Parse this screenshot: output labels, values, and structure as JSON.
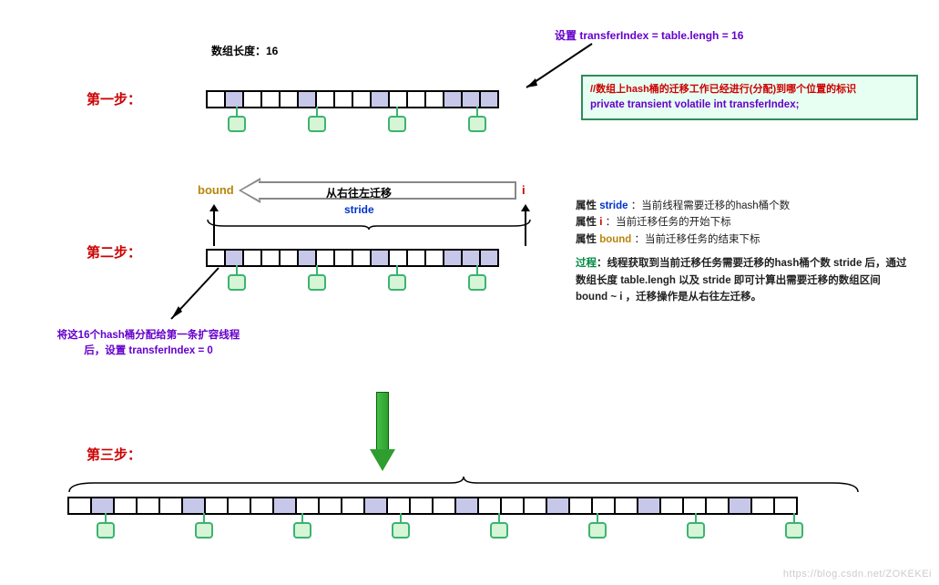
{
  "array_length_label": "数组长度：16",
  "step1_label": "第一步：",
  "step2_label": "第二步：",
  "step3_label": "第三步：",
  "set_transfer_index": "设置 transferIndex = table.lengh = 16",
  "codebox_comment": "//数组上hash桶的迁移工作已经进行(分配)到哪个位置的标识",
  "codebox_decl": "private transient volatile int transferIndex;",
  "bound_label": "bound",
  "i_label": "i",
  "stride_label": "stride",
  "migrate_label": "从右往左迁移",
  "split_index_line1": "将这16个hash桶分配给第一条扩容线程",
  "split_index_line2": "后，设置 transferIndex = 0",
  "desc_stride_prefix": "属性 ",
  "desc_stride_kw": "stride",
  "desc_stride_tail": " ：当前线程需要迁移的hash桶个数",
  "desc_i_kw": "i",
  "desc_i_tail": " ：当前迁移任务的开始下标",
  "desc_bound_kw": "bound",
  "desc_bound_tail": " ：当前迁移任务的结束下标",
  "desc_proc_kw": "过程",
  "desc_proc_tail": "：线程获取到当前迁移任务需要迁移的hash桶个数 stride 后，通过数组长度 table.lengh 以及 stride 即可计算出需要迁移的数组区间 bound ~ i ，迁移操作是从右往左迁移。",
  "watermark": "https://blog.csdn.net/ZOKEKEi",
  "chart_data": {
    "type": "diagram",
    "step1_table": {
      "length": 16,
      "filled_indices": [
        1,
        5,
        9,
        13,
        14,
        15
      ],
      "bucket_indices": [
        1,
        5,
        9,
        13
      ]
    },
    "step2_table": {
      "length": 16,
      "filled_indices": [
        1,
        5,
        9,
        13,
        14,
        15
      ],
      "bucket_indices": [
        1,
        5,
        9,
        13
      ],
      "bound_index": 0,
      "i_index": 15,
      "stride": 16,
      "direction": "right_to_left"
    },
    "step3_table": {
      "length": 32,
      "filled_indices": [
        1,
        5,
        9,
        13,
        17,
        21,
        25,
        29
      ],
      "bucket_indices": [
        1,
        5,
        9,
        13,
        17,
        21,
        25,
        29
      ]
    }
  }
}
